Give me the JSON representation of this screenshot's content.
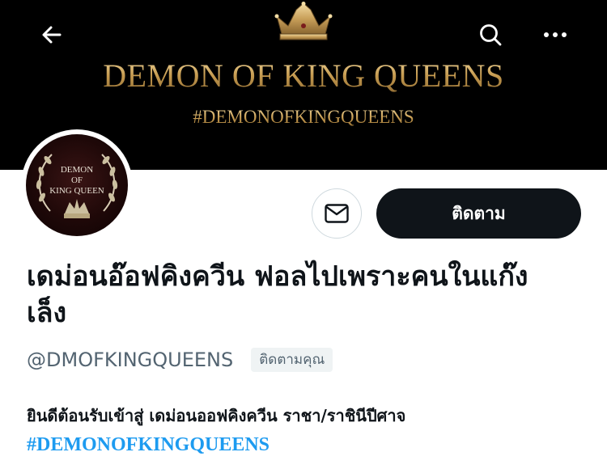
{
  "header": {
    "banner_title": "DEMON OF KING QUEENS",
    "banner_hashtag": "#DEMONOFKINGQUEENS",
    "back_icon": "arrow-left-icon",
    "search_icon": "search-icon",
    "more_icon": "more-horizontal-icon",
    "banner_gold": "#c59a4f"
  },
  "profile": {
    "avatar_text": [
      "DEMON",
      "OF",
      "KING QUEEN"
    ],
    "message_icon": "mail-icon",
    "follow_label": "ติดตาม",
    "display_name": "เดม่อนอ๊อฟคิงควีน ฟอลไปเพราะคนในแก๊งเล็ง",
    "handle": "@DMOFKINGQUEENS",
    "follows_you_label": "ติดตามคุณ",
    "bio_text": "ยินดีต้อนรับเข้าสู่ เดม่อนออฟคิงควีน ราชา/ราชินีปีศาจ",
    "bio_hashtag": "#DEMONOFKINGQUEENS",
    "link_color": "#1d9bf0",
    "text_color": "#0f1419",
    "secondary_color": "#536471"
  }
}
